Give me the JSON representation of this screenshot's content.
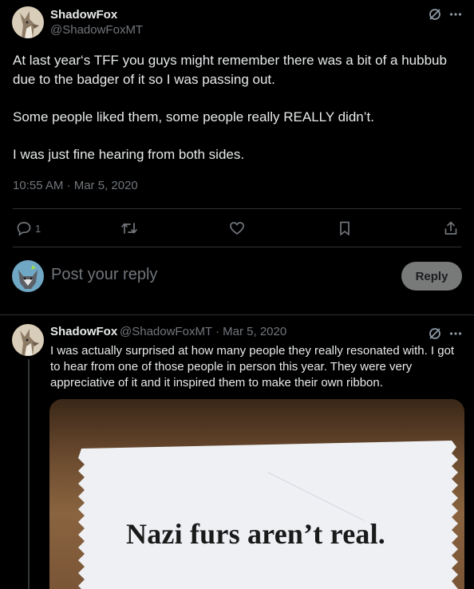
{
  "main_post": {
    "author_name": "ShadowFox",
    "author_handle": "@ShadowFoxMT",
    "paragraphs": [
      "At last year‘s TFF you guys might remember there was a bit of a hubbub due to the badger of it so I was passing out.",
      "Some people liked them, some people really REALLY didn’t.",
      "I was just fine hearing from both sides."
    ],
    "timestamp": "10:55 AM · Mar 5, 2020",
    "actions": {
      "reply_count": "1"
    }
  },
  "reply_composer": {
    "placeholder": "Post your reply",
    "button_label": "Reply"
  },
  "thread_reply": {
    "author_name": "ShadowFox",
    "author_handle": "@ShadowFoxMT",
    "date": "· Mar 5, 2020",
    "text": "I was actually surprised at how many people they really resonated with. I got to hear from one of those people in person this year. They were very appreciative of it and it inspired them to make their own ribbon.",
    "image_text": "Nazi furs aren’t real."
  },
  "icons": [
    "avatar-fox",
    "grok-icon",
    "more-icon",
    "reply-icon",
    "repost-icon",
    "like-icon",
    "bookmark-icon",
    "share-icon",
    "avatar-wolf"
  ],
  "colors": {
    "background": "#000000",
    "text_primary": "#e7e9ea",
    "text_secondary": "#71767b",
    "divider": "#2f3336",
    "reply_button": "#787a7a"
  }
}
